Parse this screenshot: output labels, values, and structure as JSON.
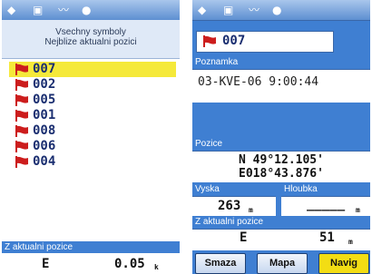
{
  "colors": {
    "accent": "#3f7fd2",
    "selection": "#f5e93a",
    "flag": "#cc1d1d"
  },
  "left": {
    "header_line1": "Vsechny symboly",
    "header_line2": "Nejblize aktualni pozici",
    "waypoints": [
      "007",
      "002",
      "005",
      "001",
      "008",
      "006",
      "004"
    ],
    "selected_index": 0,
    "bottom_label": "Z aktualni pozice",
    "bottom_dir": "E",
    "bottom_dist": "0.05",
    "bottom_unit": "k"
  },
  "right": {
    "name": "007",
    "note_label": "Poznamka",
    "note_value": "03-KVE-06 9:00:44",
    "position_label": "Pozice",
    "lat": "N  49°12.105'",
    "lon": "E018°43.876'",
    "alt_label": "Vyska",
    "depth_label": "Hloubka",
    "alt_value": "263",
    "alt_unit": "m",
    "depth_value": "_____",
    "depth_unit": "m",
    "from_label": "Z aktualni pozice",
    "from_dir": "E",
    "from_dist": "51",
    "from_unit": "m",
    "buttons": [
      "Smaza",
      "Mapa",
      "Navig"
    ]
  }
}
